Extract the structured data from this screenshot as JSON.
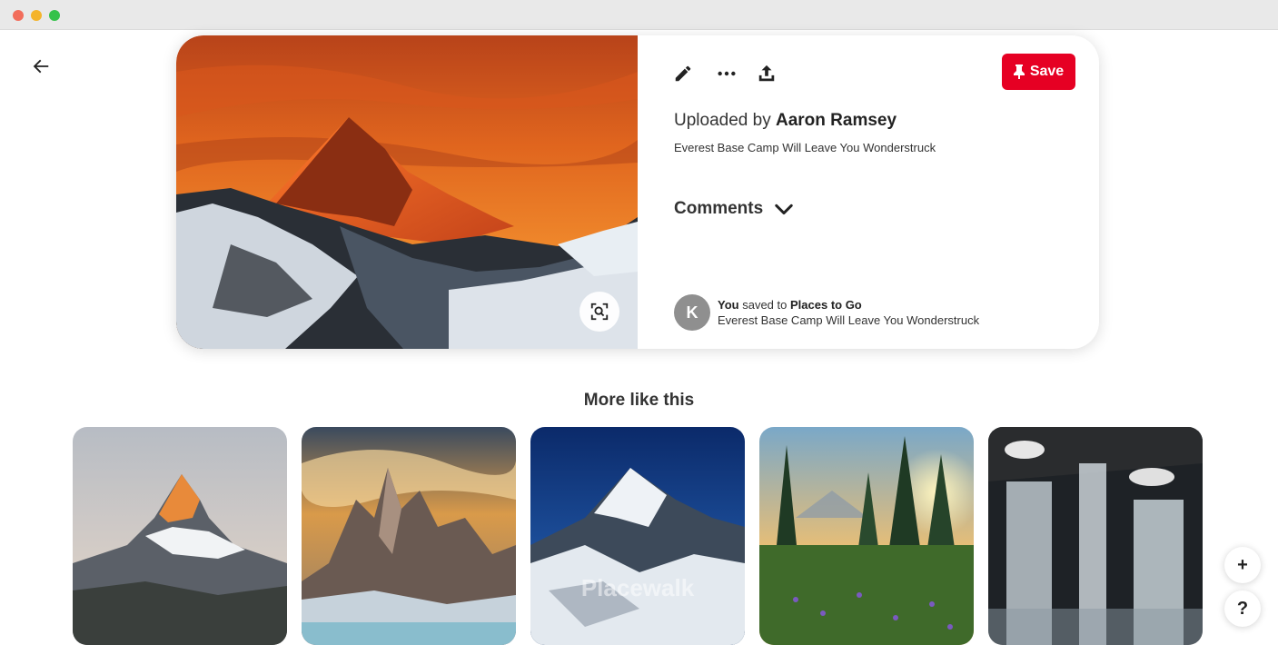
{
  "window": {
    "controls": [
      "close",
      "minimize",
      "zoom"
    ]
  },
  "nav": {
    "back_icon": "arrow-left-icon"
  },
  "pin": {
    "toolbar": {
      "edit_icon": "pencil-icon",
      "more_icon": "ellipsis-icon",
      "share_icon": "share-icon",
      "save_label": "Save",
      "save_icon": "pushpin-icon"
    },
    "uploaded_prefix": "Uploaded by",
    "uploader": "Aaron Ramsey",
    "description": "Everest Base Camp Will Leave You Wonderstruck",
    "comments_label": "Comments",
    "saved": {
      "avatar_letter": "K",
      "actor": "You",
      "verb": "saved to",
      "board": "Places to Go",
      "caption": "Everest Base Camp Will Leave You Wonderstruck"
    },
    "lens_icon": "visual-search-icon"
  },
  "more_like_this": {
    "title": "More like this",
    "items": [
      {
        "alt": "Matterhorn at dawn",
        "watermark": ""
      },
      {
        "alt": "Fitz Roy peaks with clouds",
        "watermark": ""
      },
      {
        "alt": "Everest under blue sky",
        "watermark": "Placewalk"
      },
      {
        "alt": "Sunrise through pine forest",
        "watermark": ""
      },
      {
        "alt": "Waterfall long exposure",
        "watermark": ""
      }
    ]
  },
  "floating": {
    "add_label": "+",
    "help_label": "?"
  },
  "colors": {
    "save_red": "#e60023",
    "text_dark": "#333333"
  }
}
